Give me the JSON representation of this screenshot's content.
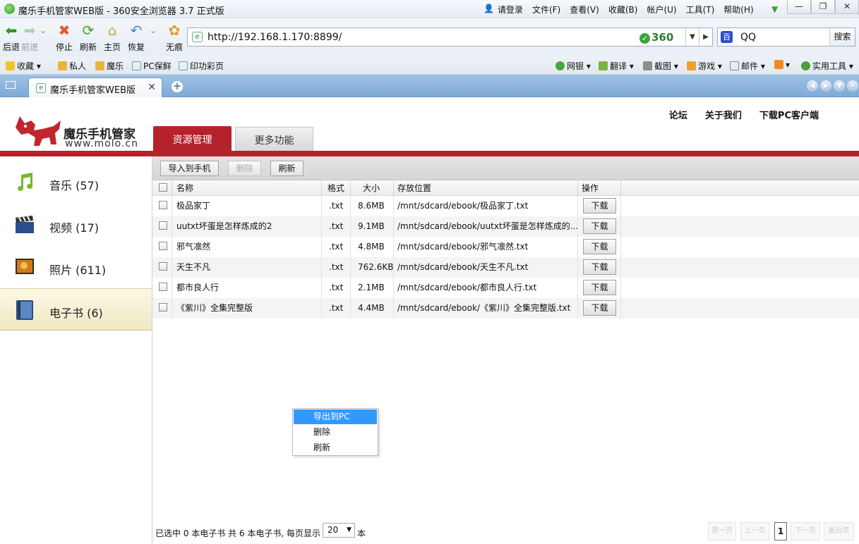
{
  "window": {
    "title": "魔乐手机管家WEB版 - 360安全浏览器 3.7 正式版",
    "login": "请登录",
    "menus": [
      "文件(F)",
      "查看(V)",
      "收藏(B)",
      "帐户(U)",
      "工具(T)",
      "帮助(H)"
    ]
  },
  "toolbar": {
    "back": "后退",
    "forward": "前进",
    "stop": "停止",
    "refresh": "刷新",
    "home": "主页",
    "restore": "恢复",
    "incognito": "无痕",
    "url": "http://192.168.1.170:8899/",
    "brand": "360",
    "search_value": "QQ",
    "search_button": "搜索"
  },
  "favorites": {
    "collect": "收藏",
    "items": [
      "私人",
      "魔乐",
      "PC保鲜",
      "印功彩页"
    ],
    "right": [
      "网银",
      "翻译",
      "截图",
      "游戏",
      "邮件",
      "实用工具"
    ]
  },
  "tabs": {
    "active_label": "魔乐手机管家WEB版"
  },
  "page": {
    "logo_name": "魔乐手机管家",
    "logo_url": "www.molo.cn",
    "top_links": [
      "论坛",
      "关于我们",
      "下载PC客户端"
    ],
    "nav_tabs": [
      "资源管理",
      "更多功能"
    ]
  },
  "sidebar": {
    "items": [
      {
        "label": "音乐 (57)",
        "icon": "music-note-icon"
      },
      {
        "label": "视频 (17)",
        "icon": "clapperboard-icon"
      },
      {
        "label": "照片 (611)",
        "icon": "photo-icon"
      },
      {
        "label": "电子书 (6)",
        "icon": "ebook-icon"
      }
    ]
  },
  "actions": {
    "import": "导入到手机",
    "delete": "删除",
    "refresh": "刷新"
  },
  "grid": {
    "columns": [
      "名称",
      "格式",
      "大小",
      "存放位置",
      "操作"
    ],
    "download_label": "下载",
    "rows": [
      {
        "name": "极品家丁",
        "format": ".txt",
        "size": "8.6MB",
        "path": "/mnt/sdcard/ebook/极品家丁.txt"
      },
      {
        "name": "uutxt坏蛋是怎样炼成的2",
        "format": ".txt",
        "size": "9.1MB",
        "path": "/mnt/sdcard/ebook/uutxt坏蛋是怎样炼成的..."
      },
      {
        "name": "邪气凛然",
        "format": ".txt",
        "size": "4.8MB",
        "path": "/mnt/sdcard/ebook/邪气凛然.txt"
      },
      {
        "name": "天生不凡",
        "format": ".txt",
        "size": "762.6KB",
        "path": "/mnt/sdcard/ebook/天生不凡.txt"
      },
      {
        "name": "都市良人行",
        "format": ".txt",
        "size": "2.1MB",
        "path": "/mnt/sdcard/ebook/都市良人行.txt"
      },
      {
        "name": "《紫川》全集完整版",
        "format": ".txt",
        "size": "4.4MB",
        "path": "/mnt/sdcard/ebook/《紫川》全集完整版.txt"
      }
    ]
  },
  "context_menu": [
    "导出到PC",
    "删除",
    "刷新"
  ],
  "footer": {
    "status": "已选中 0 本电子书 共 6 本电子书, 每页显示",
    "per_page": "20",
    "suffix": "本",
    "pager": [
      "第一页",
      "上一页",
      "1",
      "下一页",
      "最后页"
    ]
  },
  "colors": {
    "brand_red": "#b5222a",
    "highlight": "#3399ff"
  }
}
